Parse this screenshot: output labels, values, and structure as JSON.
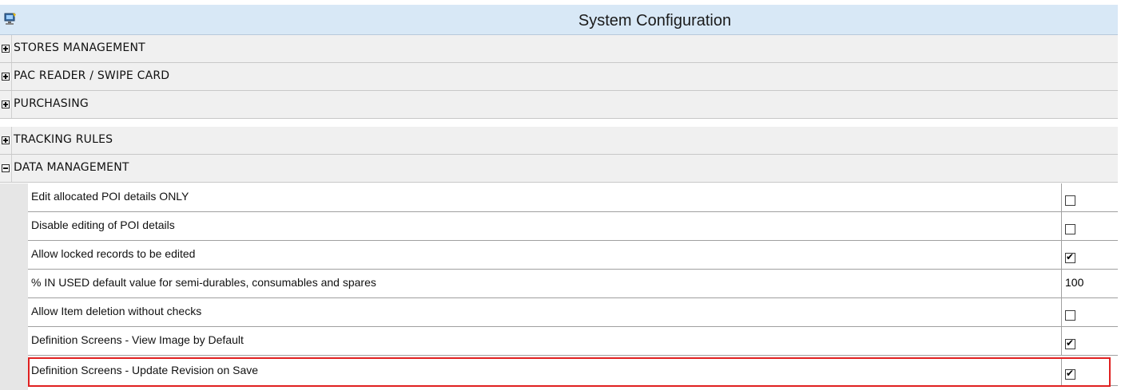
{
  "window": {
    "title": "System Configuration",
    "icon": "computer-icon"
  },
  "sections": [
    {
      "label": "STORES MANAGEMENT",
      "expanded": false
    },
    {
      "label": "PAC READER / SWIPE CARD",
      "expanded": false
    },
    {
      "label": "PURCHASING",
      "expanded": false
    },
    {
      "label": "TRACKING RULES",
      "expanded": false
    },
    {
      "label": "DATA MANAGEMENT",
      "expanded": true
    }
  ],
  "data_management_settings": [
    {
      "label": "Edit allocated POI details ONLY",
      "type": "checkbox",
      "checked": false
    },
    {
      "label": "Disable editing of POI details",
      "type": "checkbox",
      "checked": false
    },
    {
      "label": "Allow locked records to be edited",
      "type": "checkbox",
      "checked": true
    },
    {
      "label": "% IN USED default value for semi-durables, consumables and spares",
      "type": "value",
      "value": "100"
    },
    {
      "label": "Allow Item deletion without checks",
      "type": "checkbox",
      "checked": false
    },
    {
      "label": "Definition Screens - View Image by Default",
      "type": "checkbox",
      "checked": true
    },
    {
      "label": "Definition Screens - Update Revision on Save",
      "type": "checkbox",
      "checked": true
    }
  ],
  "highlight_color": "#e02020"
}
